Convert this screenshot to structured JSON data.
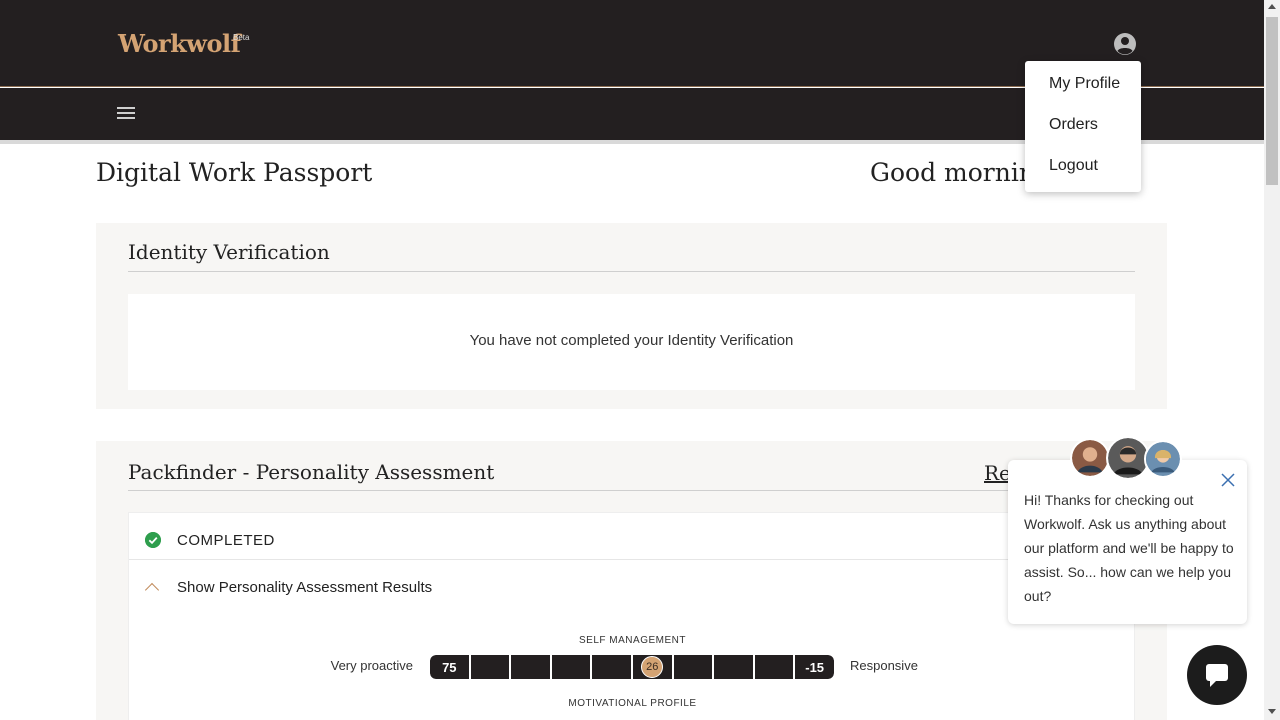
{
  "header": {
    "logo_text": "Workwolf",
    "beta_label": "Beta",
    "user_icon": "user-circle-icon",
    "menu_icon": "hamburger-menu-icon"
  },
  "page": {
    "title": "Digital Work Passport",
    "greeting": "Good morning, Ku"
  },
  "identity_verification": {
    "title": "Identity Verification",
    "message": "You have not completed your Identity Verification"
  },
  "packfinder": {
    "title": "Packfinder - Personality Assessment",
    "retake_label": "Re",
    "status": "COMPLETED",
    "toggle_label": "Show Personality Assessment Results",
    "scales": [
      {
        "title": "SELF MANAGEMENT",
        "left_label": "Very proactive",
        "right_label": "Responsive",
        "min_label": "75",
        "max_label": "-15",
        "marker_value": "26",
        "marker_segment": 5
      },
      {
        "title": "MOTIVATIONAL PROFILE"
      }
    ]
  },
  "user_menu": {
    "items": [
      {
        "label": "My Profile"
      },
      {
        "label": "Orders"
      },
      {
        "label": "Logout"
      }
    ]
  },
  "chat": {
    "message": "Hi! Thanks for checking out Workwolf. Ask us anything about our platform and we'll be happy to assist. So... how can we help you out?",
    "close_icon": "close-icon",
    "launcher_icon": "chat-bubble-icon"
  },
  "colors": {
    "header_bg": "#231f20",
    "accent": "#d4a373",
    "success": "#2e9e4d",
    "card_bg": "#f7f6f4"
  }
}
